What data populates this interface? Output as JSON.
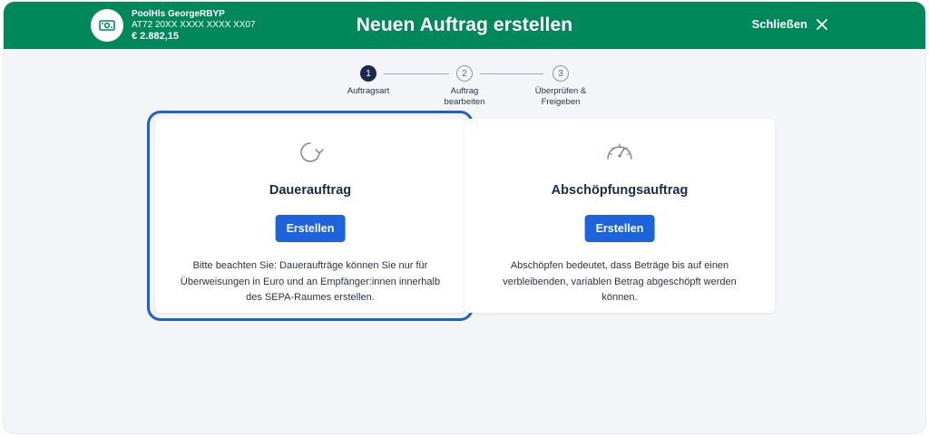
{
  "header": {
    "title": "Neuen Auftrag erstellen",
    "close_label": "Schließen",
    "background": "#00875a"
  },
  "account": {
    "name": "PoolHls GeorgeRBYP",
    "iban": "AT72 20XX XXXX XXXX XX07",
    "balance": "€ 2.882,15",
    "icon": "banknote-icon"
  },
  "stepper": {
    "steps": [
      {
        "number": "1",
        "label": "Auftragsart",
        "active": true
      },
      {
        "number": "2",
        "label": "Auftrag bearbeiten",
        "active": false
      },
      {
        "number": "3",
        "label": "Überprüfen & Freigeben",
        "active": false
      }
    ]
  },
  "cards": [
    {
      "icon": "recurring-arrow-icon",
      "title": "Dauerauftrag",
      "button_label": "Erstellen",
      "description": "Bitte beachten Sie: Daueraufträge können Sie nur für Überweisungen in Euro und an Empfänger:innen innerhalb des SEPA-Raumes erstellen.",
      "selected": true
    },
    {
      "icon": "gauge-icon",
      "title": "Abschöpfungsauftrag",
      "button_label": "Erstellen",
      "description": "Abschöpfen bedeutet, dass Beträge bis auf einen verbleibenden, variablen Betrag abgeschöpft werden können.",
      "selected": false
    }
  ],
  "colors": {
    "accent": "#1d63dc",
    "selection_outline": "#1e5fd8",
    "text_dark": "#1a2b4c"
  }
}
